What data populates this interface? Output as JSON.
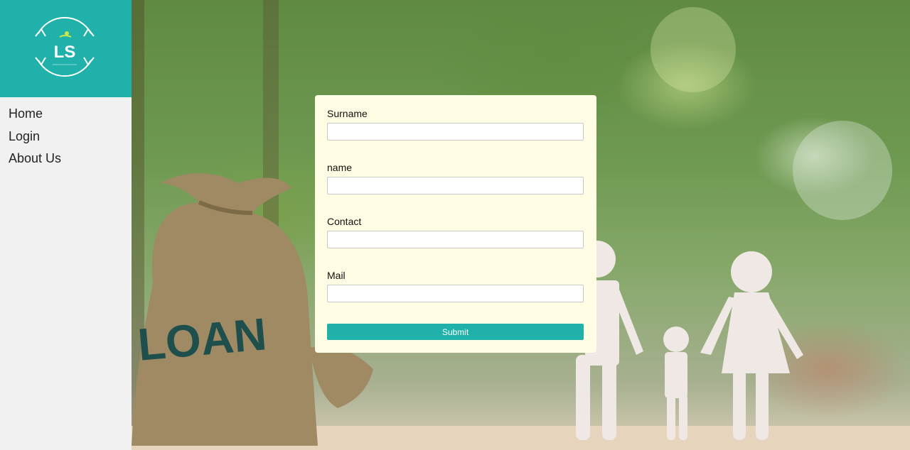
{
  "brand": {
    "logo_text": "LS",
    "accent_color": "#20b2aa"
  },
  "nav": {
    "items": [
      {
        "label": "Home"
      },
      {
        "label": "Login"
      },
      {
        "label": "About Us"
      }
    ]
  },
  "background": {
    "bag_text": "LOAN"
  },
  "form": {
    "fields": [
      {
        "label": "Surname",
        "value": "",
        "placeholder": ""
      },
      {
        "label": "name",
        "value": "",
        "placeholder": ""
      },
      {
        "label": "Contact",
        "value": "",
        "placeholder": ""
      },
      {
        "label": "Mail",
        "value": "",
        "placeholder": ""
      }
    ],
    "submit_label": "Submit",
    "card_color": "#fffde3"
  }
}
